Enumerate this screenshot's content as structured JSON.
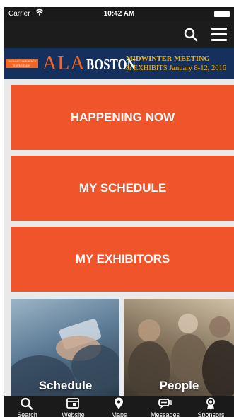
{
  "status_bar": {
    "carrier": "Carrier",
    "time": "10:42 AM"
  },
  "banner": {
    "tag_text": "THE ALA CONFERENCE EXPERIENCE",
    "ala": "ALA",
    "city": "BOSTON",
    "line1": "MIDWINTER MEETING",
    "line2": "& EXHIBITS January 8-12, 2016"
  },
  "tiles": {
    "happening_now": "HAPPENING NOW",
    "my_schedule": "MY SCHEDULE",
    "my_exhibitors": "MY EXHIBITORS"
  },
  "photos": {
    "schedule": "Schedule",
    "people": "People"
  },
  "tab_bar": [
    {
      "label": "Search",
      "icon": "search-icon"
    },
    {
      "label": "Website",
      "icon": "browser-icon"
    },
    {
      "label": "Maps",
      "icon": "map-pin-icon"
    },
    {
      "label": "Messages",
      "icon": "chat-bubble-icon"
    },
    {
      "label": "Sponsors",
      "icon": "award-ribbon-icon"
    }
  ],
  "colors": {
    "accent_orange": "#f0542a",
    "banner_navy": "#16305e",
    "banner_gold": "#f4b400",
    "bar_dark": "#1a1a1a",
    "content_bg": "#e9e9e9"
  }
}
